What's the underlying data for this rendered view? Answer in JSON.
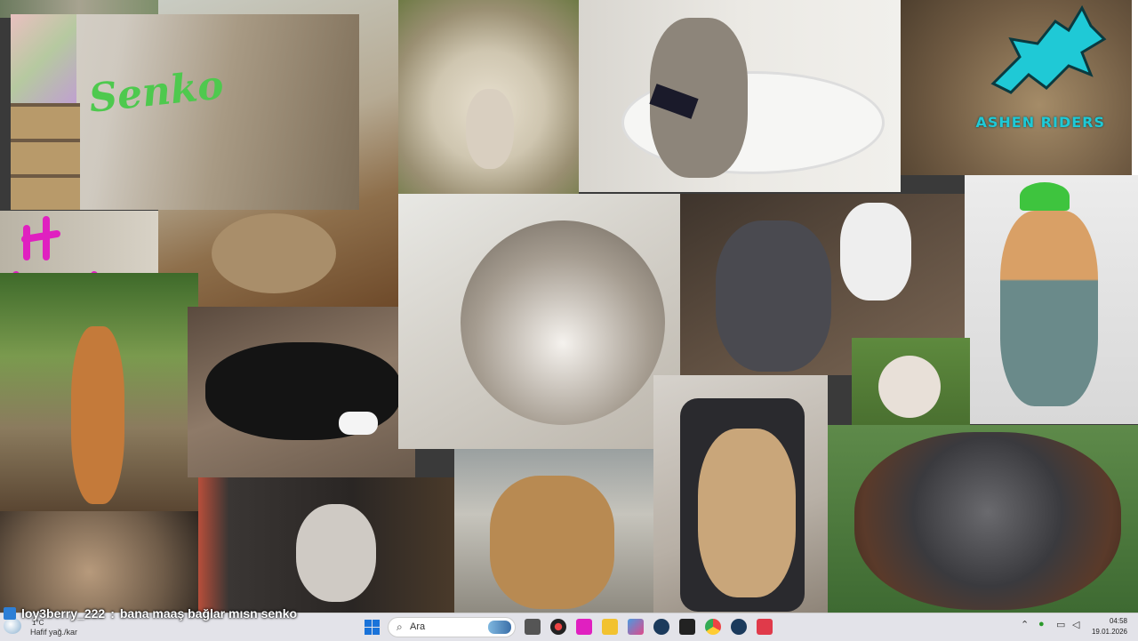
{
  "tiles": [
    {
      "name": "ashen-riders-logo-tile",
      "label": "Ashen Riders logo tile"
    },
    {
      "name": "sheep-tile"
    },
    {
      "name": "cat-toilet-tile"
    },
    {
      "name": "frog-tile"
    }
  ],
  "logo": {
    "text": "ASHEN RIDERS"
  },
  "webcam": {
    "graffiti": "Senko"
  },
  "chat": {
    "user": "loy3berry_222",
    "separator": " : ",
    "message": "bana maaş bağlar mısn senko"
  },
  "taskbar": {
    "weather": {
      "temp": "1°C",
      "description": "Hafif yağ./kar"
    },
    "search": {
      "placeholder": "Ara"
    },
    "clock": {
      "time": "04:58",
      "date": "19.01.2026"
    },
    "apps": [
      "files",
      "chrome-alt",
      "figma",
      "folder",
      "store",
      "steam",
      "epic",
      "chrome",
      "steam-2",
      "vivaldi"
    ]
  },
  "colors": {
    "accent": "#1a73d9",
    "logo": "#1fc9d6",
    "graffiti": "#4ec94e"
  }
}
